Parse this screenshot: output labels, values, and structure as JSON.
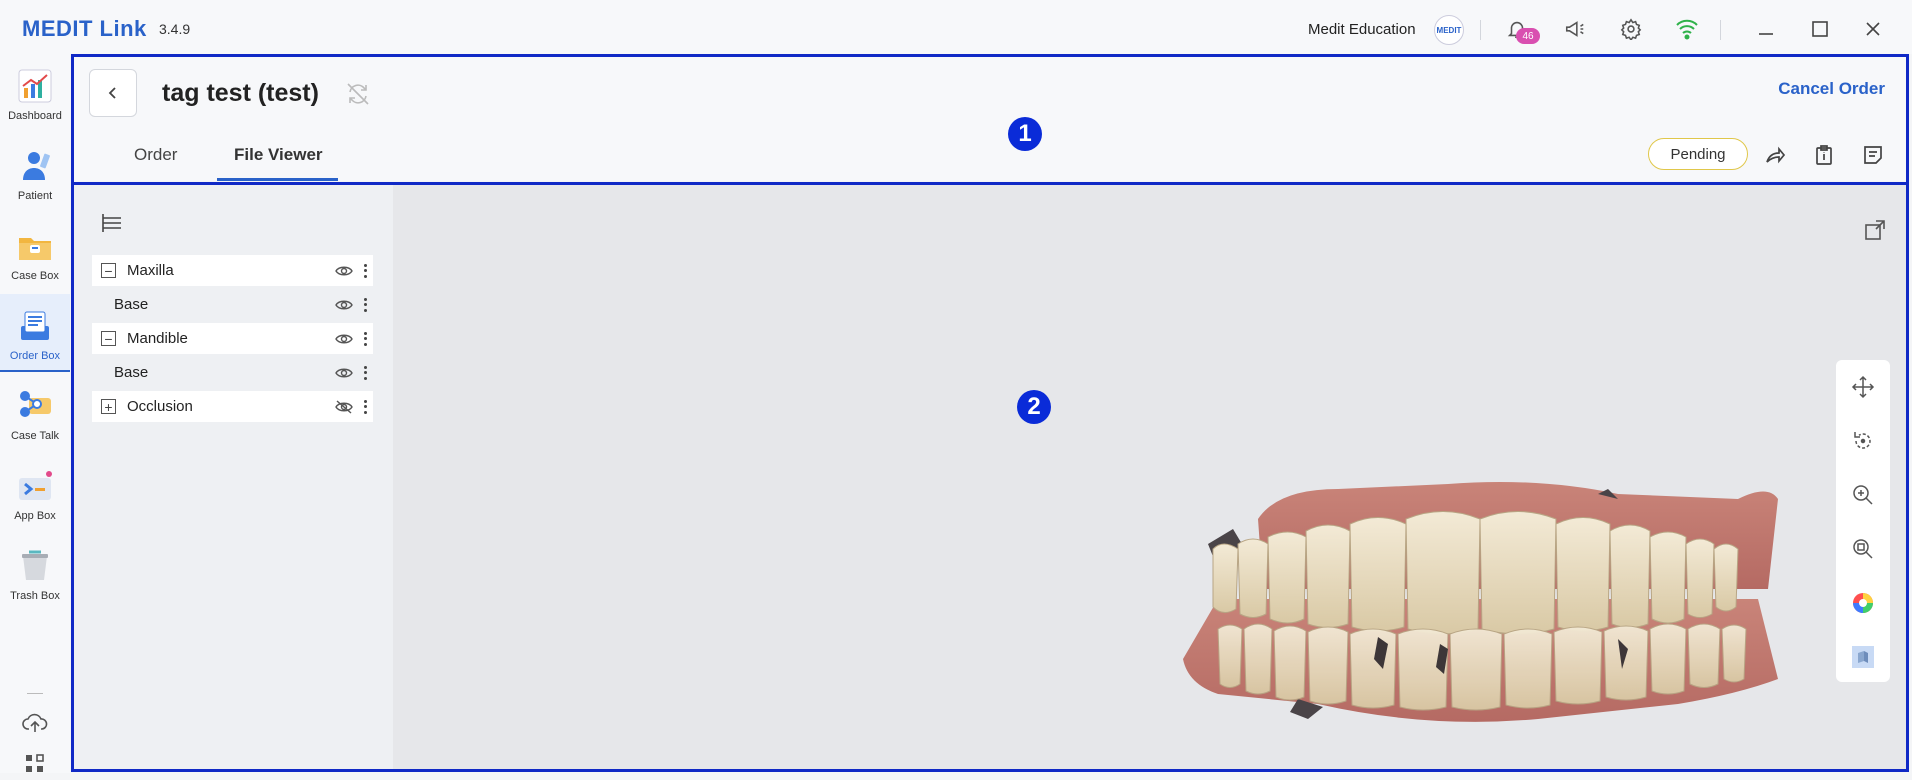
{
  "app": {
    "brand": "MEDIT Link",
    "version": "3.4.9"
  },
  "titlebar": {
    "user_name": "Medit Education",
    "avatar_text": "MEDIT",
    "notifications_count": "46"
  },
  "nav": {
    "items": [
      {
        "label": "Dashboard",
        "icon": "dashboard-icon"
      },
      {
        "label": "Patient",
        "icon": "patient-icon"
      },
      {
        "label": "Case Box",
        "icon": "case-box-icon"
      },
      {
        "label": "Order Box",
        "icon": "order-box-icon",
        "active": true
      },
      {
        "label": "Case Talk",
        "icon": "case-talk-icon"
      },
      {
        "label": "App Box",
        "icon": "app-box-icon"
      },
      {
        "label": "Trash Box",
        "icon": "trash-box-icon"
      }
    ]
  },
  "header": {
    "title": "tag test (test)",
    "cancel_label": "Cancel Order",
    "tabs": [
      {
        "label": "Order"
      },
      {
        "label": "File Viewer",
        "active": true
      }
    ],
    "status": "Pending"
  },
  "markers": {
    "one": "1",
    "two": "2"
  },
  "tree": {
    "items": [
      {
        "label": "Maxilla",
        "type": "parent",
        "expander": "−",
        "visible": true
      },
      {
        "label": "Base",
        "type": "child",
        "visible": true
      },
      {
        "label": "Mandible",
        "type": "parent",
        "expander": "−",
        "visible": true
      },
      {
        "label": "Base",
        "type": "child",
        "visible": true
      },
      {
        "label": "Occlusion",
        "type": "parent",
        "expander": "+",
        "visible": false
      }
    ]
  },
  "colors": {
    "accent": "#2a62c9",
    "region_outline": "#1029c6",
    "marker": "#0a2bd8",
    "pending_border": "#e0c74a",
    "wifi": "#2fb24a",
    "badge": "#d94fb0"
  }
}
